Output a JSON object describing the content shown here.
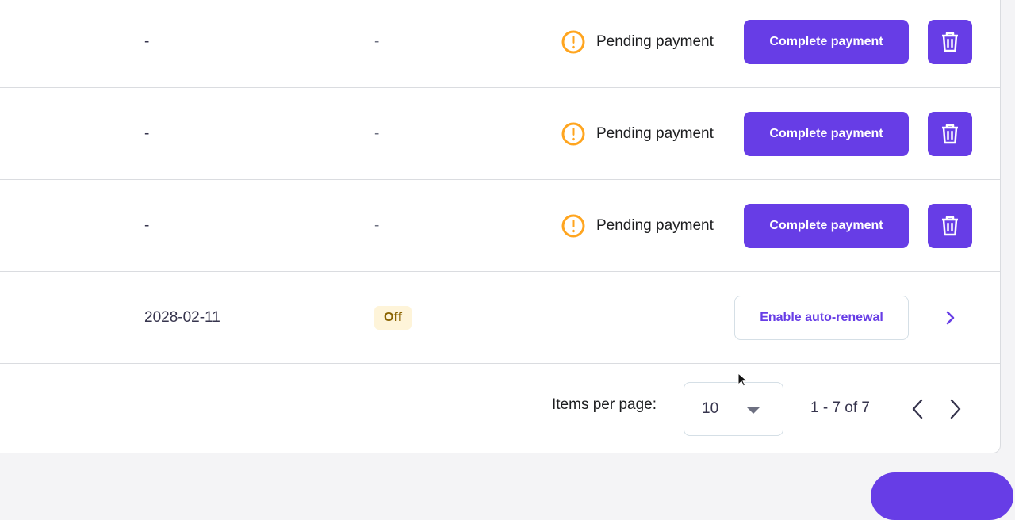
{
  "rows": [
    {
      "col_a": "-",
      "col_b": "-",
      "status": "Pending payment",
      "action": "Complete payment"
    },
    {
      "col_a": "-",
      "col_b": "-",
      "status": "Pending payment",
      "action": "Complete payment"
    },
    {
      "col_a": "-",
      "col_b": "-",
      "status": "Pending payment",
      "action": "Complete payment"
    }
  ],
  "renewal_row": {
    "date": "2028-02-11",
    "auto_renew_badge": "Off",
    "action": "Enable auto-renewal"
  },
  "pagination": {
    "items_per_page_label": "Items per page:",
    "items_per_page_value": "10",
    "range": "1 - 7 of 7"
  },
  "colors": {
    "primary": "#673de6",
    "warning": "#ffa51f",
    "badge_bg": "#fef4d9"
  },
  "icons": {
    "status": "warning-circle-icon",
    "delete": "trash-icon",
    "row_open": "chevron-right-icon"
  }
}
